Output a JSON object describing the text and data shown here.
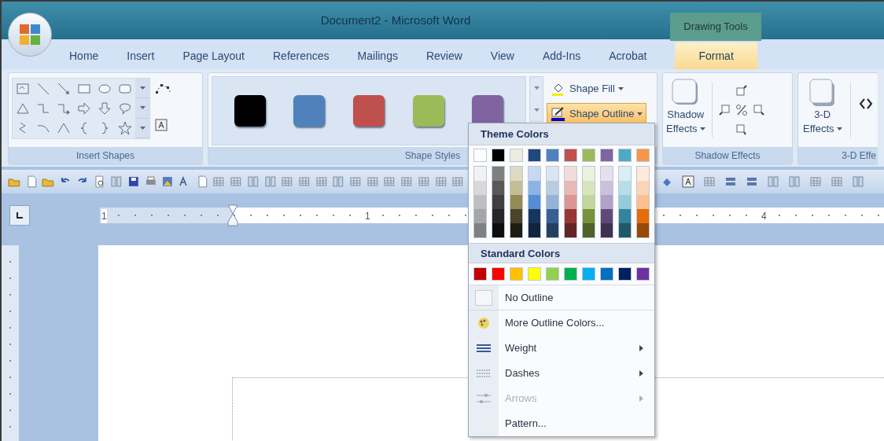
{
  "window": {
    "title": "Document2 - Microsoft Word"
  },
  "contextual_group": "Drawing Tools",
  "tabs": [
    {
      "label": "Home",
      "selected": false
    },
    {
      "label": "Insert",
      "selected": false
    },
    {
      "label": "Page Layout",
      "selected": false
    },
    {
      "label": "References",
      "selected": false
    },
    {
      "label": "Mailings",
      "selected": false
    },
    {
      "label": "Review",
      "selected": false
    },
    {
      "label": "View",
      "selected": false
    },
    {
      "label": "Add-Ins",
      "selected": false
    },
    {
      "label": "Acrobat",
      "selected": false
    },
    {
      "label": "Format",
      "selected": true
    }
  ],
  "ribbon": {
    "insert_shapes": {
      "label": "Insert Shapes"
    },
    "shape_styles": {
      "label": "Shape Styles",
      "swatches": [
        {
          "color": "#000000"
        },
        {
          "color": "#4f81bd"
        },
        {
          "color": "#c0504d"
        },
        {
          "color": "#9bbb59"
        },
        {
          "color": "#8064a2"
        }
      ],
      "buttons": [
        {
          "label": "Shape Fill",
          "pressed": false
        },
        {
          "label": "Shape Outline",
          "pressed": true
        }
      ]
    },
    "shadow_effects": {
      "label": "Shadow Effects",
      "button": [
        "Shadow",
        "Effects"
      ]
    },
    "three_d_effects": {
      "label": "3-D Effe",
      "button": [
        "3-D",
        "Effects"
      ]
    }
  },
  "ruler": {
    "labels": [
      "1",
      "1",
      "4"
    ]
  },
  "menu": {
    "theme_heading": "Theme Colors",
    "theme_columns": [
      {
        "color": "#ffffff",
        "shades": [
          {
            "color": "#f2f2f2"
          },
          {
            "color": "#d9d9d9"
          },
          {
            "color": "#bfbfbf"
          },
          {
            "color": "#a6a6a6"
          },
          {
            "color": "#808080"
          }
        ]
      },
      {
        "color": "#000000",
        "shades": [
          {
            "color": "#7f7f7f"
          },
          {
            "color": "#595959"
          },
          {
            "color": "#404040"
          },
          {
            "color": "#262626"
          },
          {
            "color": "#0d0d0d"
          }
        ]
      },
      {
        "color": "#eeece1",
        "shades": [
          {
            "color": "#ddd9c3"
          },
          {
            "color": "#c4bd97"
          },
          {
            "color": "#948a54"
          },
          {
            "color": "#4a452a"
          },
          {
            "color": "#1e1c11"
          }
        ]
      },
      {
        "color": "#1f497d",
        "shades": [
          {
            "color": "#c6d9f1"
          },
          {
            "color": "#8db3e2"
          },
          {
            "color": "#548dd4"
          },
          {
            "color": "#17365d"
          },
          {
            "color": "#0f243e"
          }
        ]
      },
      {
        "color": "#4f81bd",
        "shades": [
          {
            "color": "#dbe5f1"
          },
          {
            "color": "#b8cce4"
          },
          {
            "color": "#95b3d7"
          },
          {
            "color": "#366092"
          },
          {
            "color": "#244061"
          }
        ]
      },
      {
        "color": "#c0504d",
        "shades": [
          {
            "color": "#f2dcdb"
          },
          {
            "color": "#e6b9b8"
          },
          {
            "color": "#d99694"
          },
          {
            "color": "#953735"
          },
          {
            "color": "#632423"
          }
        ]
      },
      {
        "color": "#9bbb59",
        "shades": [
          {
            "color": "#ebf1de"
          },
          {
            "color": "#d7e4bd"
          },
          {
            "color": "#c3d69b"
          },
          {
            "color": "#76923c"
          },
          {
            "color": "#4f6228"
          }
        ]
      },
      {
        "color": "#8064a2",
        "shades": [
          {
            "color": "#e5e0ec"
          },
          {
            "color": "#ccc1da"
          },
          {
            "color": "#b2a2c7"
          },
          {
            "color": "#5f497a"
          },
          {
            "color": "#3f3151"
          }
        ]
      },
      {
        "color": "#4bacc6",
        "shades": [
          {
            "color": "#dbeef4"
          },
          {
            "color": "#b7dee8"
          },
          {
            "color": "#93cddd"
          },
          {
            "color": "#31859c"
          },
          {
            "color": "#205867"
          }
        ]
      },
      {
        "color": "#f79646",
        "shades": [
          {
            "color": "#fdeada"
          },
          {
            "color": "#fbd5b5"
          },
          {
            "color": "#fac08f"
          },
          {
            "color": "#e46c0a"
          },
          {
            "color": "#984807"
          }
        ]
      }
    ],
    "standard_heading": "Standard Colors",
    "standard_colors": [
      {
        "color": "#c00000"
      },
      {
        "color": "#ff0000"
      },
      {
        "color": "#ffc000"
      },
      {
        "color": "#ffff00"
      },
      {
        "color": "#92d050"
      },
      {
        "color": "#00b050"
      },
      {
        "color": "#00b0f0"
      },
      {
        "color": "#0070c0"
      },
      {
        "color": "#002060"
      },
      {
        "color": "#7030a0"
      }
    ],
    "items": [
      {
        "kind": "no_color",
        "label": "No Outline",
        "disabled": false,
        "submenu": false
      },
      {
        "kind": "palette",
        "label": "More Outline Colors...",
        "disabled": false,
        "submenu": false
      },
      {
        "kind": "weight",
        "label": "Weight",
        "disabled": false,
        "submenu": true
      },
      {
        "kind": "dashes",
        "label": "Dashes",
        "disabled": false,
        "submenu": true
      },
      {
        "kind": "arrows",
        "label": "Arrows",
        "disabled": true,
        "submenu": true
      },
      {
        "kind": "plain",
        "label": "Pattern...",
        "disabled": false,
        "submenu": false
      }
    ]
  }
}
